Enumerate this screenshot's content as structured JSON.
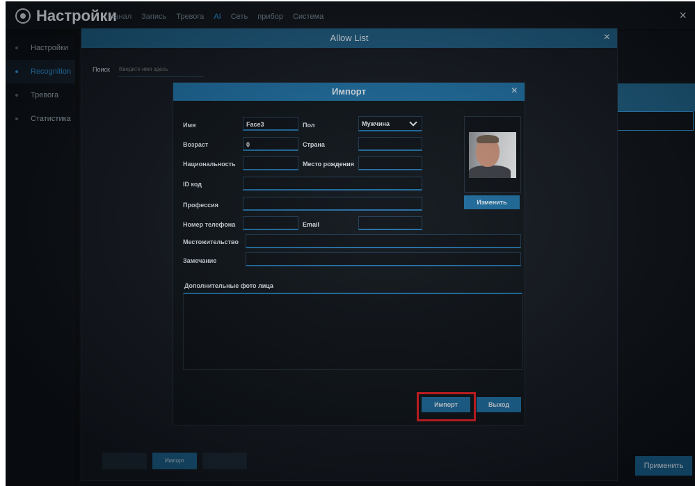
{
  "topbar": {
    "title": "Настройки",
    "nav": [
      "Канал",
      "Запись",
      "Тревога",
      "AI",
      "Сеть",
      "прибор",
      "Система"
    ],
    "active_nav": "AI",
    "close_icon": "×"
  },
  "sidebar": {
    "items": [
      {
        "label": "Настройки"
      },
      {
        "label": "Recognition"
      },
      {
        "label": "Тревога"
      },
      {
        "label": "Статистика"
      }
    ]
  },
  "allow_list": {
    "title": "Allow List",
    "close_icon": "×",
    "search_label": "Поиск",
    "search_placeholder": "Введите имя здесь",
    "import_button": "Импорт",
    "apply_button": "Применить"
  },
  "import_dialog": {
    "title": "Импорт",
    "close_icon": "×",
    "fields": {
      "name": {
        "label": "Имя",
        "value": "Face3"
      },
      "gender": {
        "label": "Пол",
        "value": "Мужчина"
      },
      "age": {
        "label": "Возраст",
        "value": "0"
      },
      "country": {
        "label": "Страна",
        "value": ""
      },
      "nationality": {
        "label": "Национальность",
        "value": ""
      },
      "birthplace": {
        "label": "Место рождения",
        "value": ""
      },
      "id_code": {
        "label": "ID код",
        "value": ""
      },
      "profession": {
        "label": "Профессия",
        "value": ""
      },
      "phone": {
        "label": "Номер телефона",
        "value": ""
      },
      "email": {
        "label": "Email",
        "value": ""
      },
      "residence": {
        "label": "Местожительство",
        "value": ""
      },
      "note": {
        "label": "Замечание",
        "value": ""
      }
    },
    "change_button": "Изменить",
    "extra_photos_label": "Дополнительные фото лица",
    "import_button": "Импорт",
    "exit_button": "Выход"
  },
  "colors": {
    "accent": "#1d6fa3",
    "highlight": "#e81e24"
  }
}
